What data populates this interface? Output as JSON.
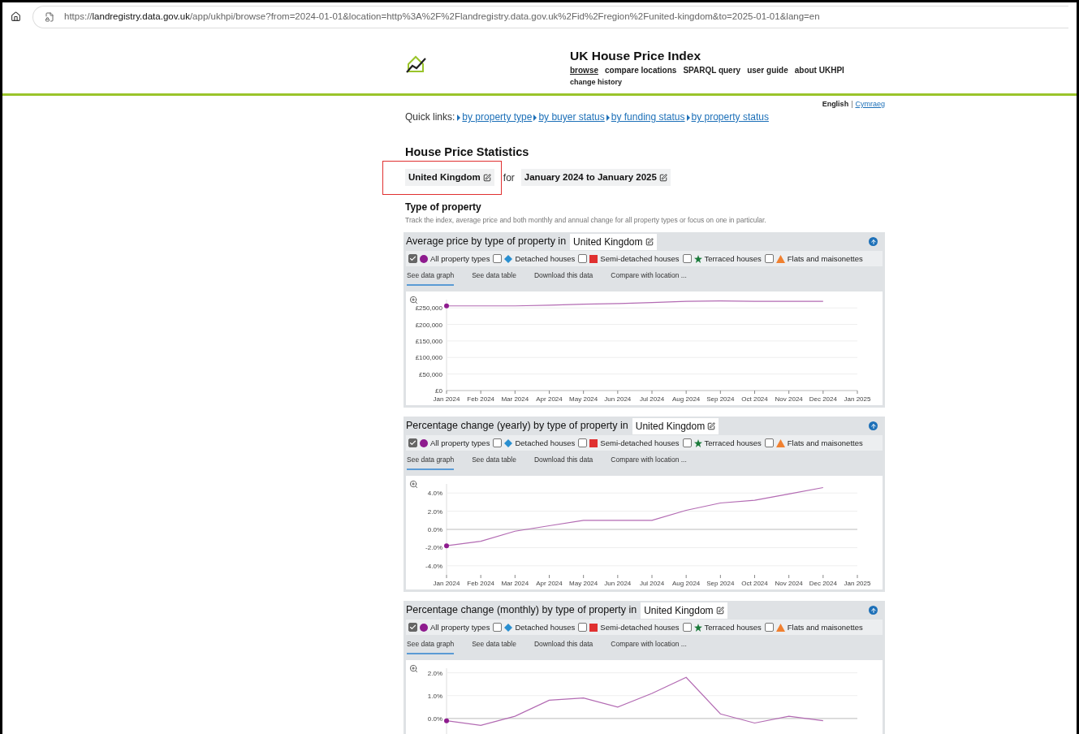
{
  "browser": {
    "url": "https://**landregistry.data.gov.uk**/app/ukhpi/browse?from=2024-01-01&location=http%3A%2F%2Flandregistry.data.gov.uk%2Fid%2Fregion%2Funited-kingdom&to=2025-01-01&lang=en"
  },
  "site": {
    "title": "UK House Price Index",
    "nav": [
      {
        "label": "browse",
        "selected": true
      },
      {
        "label": "compare locations",
        "selected": false
      },
      {
        "label": "SPARQL query",
        "selected": false
      },
      {
        "label": "user guide",
        "selected": false
      },
      {
        "label": "about UKHPI",
        "selected": false
      },
      {
        "label": "change history",
        "selected": false
      }
    ]
  },
  "language": {
    "separator": "|",
    "options": [
      {
        "label": "English",
        "selected": true
      },
      {
        "label": "Cymraeg",
        "selected": false
      }
    ]
  },
  "quick_links": {
    "label": "Quick links:",
    "links": [
      "by property type",
      "by buyer status",
      "by funding status",
      "by property status"
    ]
  },
  "heading": "House Price Statistics",
  "selection": {
    "location": "United Kingdom",
    "connector": "for",
    "period": "January 2024 to January 2025"
  },
  "section": {
    "title": "Type of property",
    "description": "Track the index, average price and both monthly and annual change for all property types or focus on one in particular."
  },
  "panels": [
    {
      "title": "Average price by type of property in",
      "location": "United Kingdom",
      "legend": [
        {
          "label": "All property types",
          "checked": true,
          "kind": "circle",
          "color": "#8e1b8e"
        },
        {
          "label": "Detached houses",
          "checked": false,
          "kind": "diamond",
          "color": "#2a8fd0"
        },
        {
          "label": "Semi-detached houses",
          "checked": false,
          "kind": "square",
          "color": "#e03030"
        },
        {
          "label": "Terraced houses",
          "checked": false,
          "kind": "star",
          "color": "#1a7a3a"
        },
        {
          "label": "Flats and maisonettes",
          "checked": false,
          "kind": "triangle",
          "color": "#f08030"
        }
      ],
      "tabs": [
        {
          "label": "See data graph",
          "selected": true
        },
        {
          "label": "See data table",
          "selected": false
        },
        {
          "label": "Download this data",
          "selected": false
        },
        {
          "label": "Compare with location ...",
          "selected": false
        }
      ],
      "chart_data": {
        "type": "line",
        "grid": true,
        "ylim": [
          0,
          275000
        ],
        "categories": [
          "Jan 2024",
          "Feb 2024",
          "Mar 2024",
          "Apr 2024",
          "May 2024",
          "Jun 2024",
          "Jul 2024",
          "Aug 2024",
          "Sep 2024",
          "Oct 2024",
          "Nov 2024",
          "Dec 2024",
          "Jan 2025"
        ],
        "yticks": [
          {
            "value": 0,
            "label": "£0"
          },
          {
            "value": 50000,
            "label": "£50,000"
          },
          {
            "value": 100000,
            "label": "£100,000"
          },
          {
            "value": 150000,
            "label": "£150,000"
          },
          {
            "value": 200000,
            "label": "£200,000"
          },
          {
            "value": 250000,
            "label": "£250,000"
          }
        ],
        "series": [
          {
            "color": "#b36bb3",
            "values": [
              256000,
              256000,
              256000,
              258000,
              261000,
              263000,
              266000,
              270000,
              271000,
              270000,
              270000,
              270000,
              null
            ]
          }
        ]
      }
    },
    {
      "title": "Percentage change (yearly) by type of property in",
      "location": "United Kingdom",
      "legend": [
        {
          "label": "All property types",
          "checked": true,
          "kind": "circle",
          "color": "#8e1b8e"
        },
        {
          "label": "Detached houses",
          "checked": false,
          "kind": "diamond",
          "color": "#2a8fd0"
        },
        {
          "label": "Semi-detached houses",
          "checked": false,
          "kind": "square",
          "color": "#e03030"
        },
        {
          "label": "Terraced houses",
          "checked": false,
          "kind": "star",
          "color": "#1a7a3a"
        },
        {
          "label": "Flats and maisonettes",
          "checked": false,
          "kind": "triangle",
          "color": "#f08030"
        }
      ],
      "tabs": [
        {
          "label": "See data graph",
          "selected": true
        },
        {
          "label": "See data table",
          "selected": false
        },
        {
          "label": "Download this data",
          "selected": false
        },
        {
          "label": "Compare with location ...",
          "selected": false
        }
      ],
      "chart_data": {
        "type": "line",
        "grid": true,
        "ylim": [
          -5,
          5
        ],
        "categories": [
          "Jan 2024",
          "Feb 2024",
          "Mar 2024",
          "Apr 2024",
          "May 2024",
          "Jun 2024",
          "Jul 2024",
          "Aug 2024",
          "Sep 2024",
          "Oct 2024",
          "Nov 2024",
          "Dec 2024",
          "Jan 2025"
        ],
        "yticks": [
          {
            "value": -4,
            "label": "-4.0%"
          },
          {
            "value": -2,
            "label": "-2.0%"
          },
          {
            "value": 0,
            "label": "0.0%"
          },
          {
            "value": 2,
            "label": "2.0%"
          },
          {
            "value": 4,
            "label": "4.0%"
          }
        ],
        "series": [
          {
            "color": "#b36bb3",
            "values": [
              -1.8,
              -1.3,
              -0.2,
              0.4,
              1.0,
              1.0,
              1.0,
              2.1,
              2.9,
              3.2,
              3.9,
              4.6,
              null
            ]
          }
        ]
      }
    },
    {
      "title": "Percentage change (monthly) by type of property in",
      "location": "United Kingdom",
      "legend": [
        {
          "label": "All property types",
          "checked": true,
          "kind": "circle",
          "color": "#8e1b8e"
        },
        {
          "label": "Detached houses",
          "checked": false,
          "kind": "diamond",
          "color": "#2a8fd0"
        },
        {
          "label": "Semi-detached houses",
          "checked": false,
          "kind": "square",
          "color": "#e03030"
        },
        {
          "label": "Terraced houses",
          "checked": false,
          "kind": "star",
          "color": "#1a7a3a"
        },
        {
          "label": "Flats and maisonettes",
          "checked": false,
          "kind": "triangle",
          "color": "#f08030"
        }
      ],
      "tabs": [
        {
          "label": "See data graph",
          "selected": true
        },
        {
          "label": "See data table",
          "selected": false
        },
        {
          "label": "Download this data",
          "selected": false
        },
        {
          "label": "Compare with location ...",
          "selected": false
        }
      ],
      "chart_data": {
        "type": "line",
        "grid": true,
        "ylim": [
          -1,
          2.2
        ],
        "yticks": [
          {
            "value": 0,
            "label": "0.0%"
          },
          {
            "value": 1,
            "label": "1.0%"
          },
          {
            "value": 2,
            "label": "2.0%"
          }
        ],
        "series": [
          {
            "color": "#b36bb3",
            "values": [
              -0.1,
              -0.3,
              0.1,
              0.8,
              0.9,
              0.5,
              1.1,
              1.8,
              0.2,
              -0.2,
              0.1,
              -0.1
            ]
          }
        ]
      }
    }
  ]
}
